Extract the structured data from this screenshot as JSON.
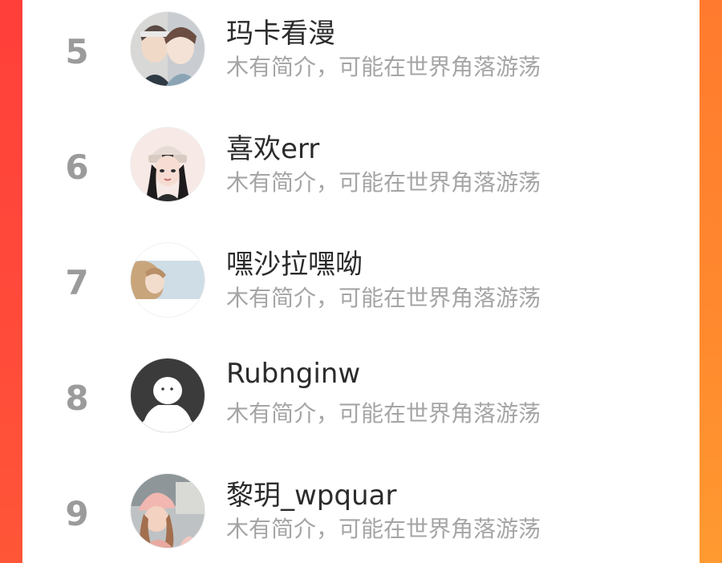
{
  "leaderboard": {
    "entries": [
      {
        "rank": "5",
        "name": "玛卡看漫",
        "bio": "木有简介，可能在世界角落游荡",
        "avatar": "couple-illustration-avatar"
      },
      {
        "rank": "6",
        "name": "喜欢err",
        "bio": "木有简介，可能在世界角落游荡",
        "avatar": "girl-beanie-illustration-avatar"
      },
      {
        "rank": "7",
        "name": "嘿沙拉嘿呦",
        "bio": "木有简介，可能在世界角落游荡",
        "avatar": "blonde-girl-photo-avatar"
      },
      {
        "rank": "8",
        "name": "Rubnginw",
        "bio": "木有简介，可能在世界角落游荡",
        "avatar": "default-user-avatar"
      },
      {
        "rank": "9",
        "name": "黎玥_wpquar",
        "bio": "木有简介，可能在世界角落游荡",
        "avatar": "pink-cap-girl-photo-avatar"
      }
    ]
  },
  "colors": {
    "rank_text": "#9b9b9b",
    "name_text": "#2b2b2b",
    "bio_text": "#a5a5a5",
    "left_border": "#ff4b3a",
    "right_border": "#ff8a2e"
  }
}
